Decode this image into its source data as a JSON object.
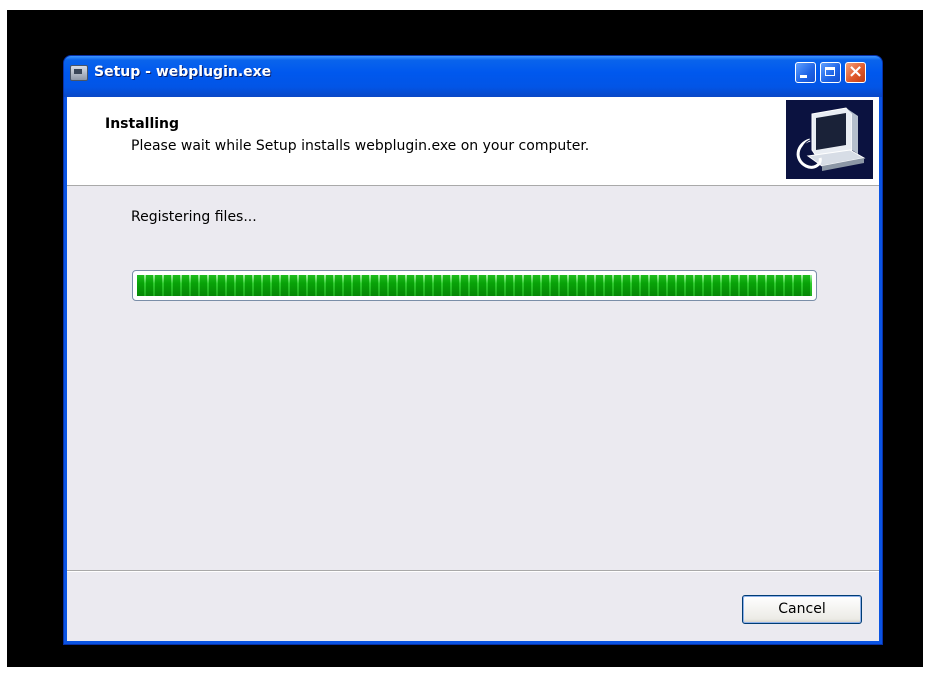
{
  "window": {
    "title": "Setup - webplugin.exe"
  },
  "header": {
    "title": "Installing",
    "subtitle": "Please wait while Setup installs webplugin.exe on your computer."
  },
  "main": {
    "status": "Registering files...",
    "progress_fraction": 1.0
  },
  "footer": {
    "cancel_label": "Cancel"
  },
  "icons": {
    "app": "setup-app-icon",
    "wizard": "computer-install-icon",
    "minimize": "minimize-icon",
    "maximize": "maximize-icon",
    "close": "close-icon"
  },
  "colors": {
    "titlebar": "#0058ee",
    "progress": "#2fcb2f",
    "close_button": "#e05a2c"
  }
}
